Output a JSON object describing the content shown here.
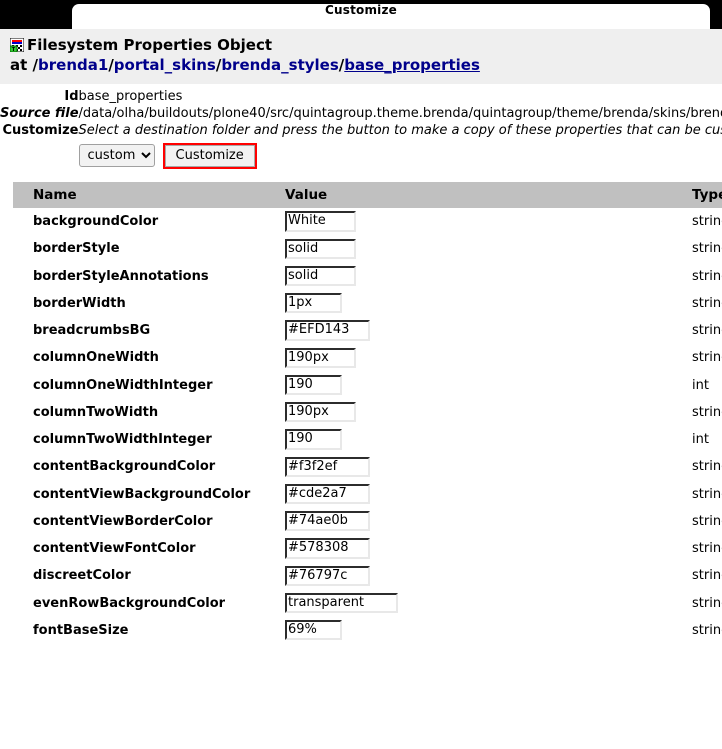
{
  "tabbar": {
    "active_tab": "Customize"
  },
  "title": {
    "icon": "properties-object-icon",
    "prefix": "Filesystem Properties Object at",
    "path_segments": [
      {
        "sep": "/",
        "text": "brenda1",
        "underline": false
      },
      {
        "sep": "/",
        "text": "portal_skins",
        "underline": false
      },
      {
        "sep": "/",
        "text": "brenda_styles",
        "underline": false
      },
      {
        "sep": "/",
        "text": "base_properties",
        "underline": true
      }
    ]
  },
  "info": {
    "rows": [
      {
        "label": "Id",
        "label_italic": false,
        "value": "base_properties",
        "value_italic": false
      },
      {
        "label": "Source file",
        "label_italic": true,
        "value": "/data/olha/buildouts/plone40/src/quintagroup.theme.brenda/quintagroup/theme/brenda/skins/brenda_styles/base_properties.props",
        "value_italic": false
      },
      {
        "label": "Customize",
        "label_italic": false,
        "value": "Select a destination folder and press the button to make a copy of these properties that can be customized.",
        "value_italic": true
      }
    ]
  },
  "form": {
    "destination_select": {
      "name": "destination-folder-select",
      "selected": "custom",
      "options": [
        "custom"
      ]
    },
    "customize_button": "Customize",
    "highlight_color": "#ff0000"
  },
  "props_table": {
    "columns": [
      "Name",
      "Value",
      "Type"
    ],
    "header_bg": "#c0c0c0",
    "rows": [
      {
        "name": "backgroundColor",
        "value": "White",
        "type": "string",
        "size": 5
      },
      {
        "name": "borderStyle",
        "value": "solid",
        "type": "string",
        "size": 5
      },
      {
        "name": "borderStyleAnnotations",
        "value": "solid",
        "type": "string",
        "size": 5
      },
      {
        "name": "borderWidth",
        "value": "1px",
        "type": "string",
        "size": 3
      },
      {
        "name": "breadcrumbsBG",
        "value": "#EFD143",
        "type": "string",
        "size": 7
      },
      {
        "name": "columnOneWidth",
        "value": "190px",
        "type": "string",
        "size": 5
      },
      {
        "name": "columnOneWidthInteger",
        "value": "190",
        "type": "int",
        "size": 3
      },
      {
        "name": "columnTwoWidth",
        "value": "190px",
        "type": "string",
        "size": 5
      },
      {
        "name": "columnTwoWidthInteger",
        "value": "190",
        "type": "int",
        "size": 3
      },
      {
        "name": "contentBackgroundColor",
        "value": "#f3f2ef",
        "type": "string",
        "size": 7
      },
      {
        "name": "contentViewBackgroundColor",
        "value": "#cde2a7",
        "type": "string",
        "size": 7
      },
      {
        "name": "contentViewBorderColor",
        "value": "#74ae0b",
        "type": "string",
        "size": 7
      },
      {
        "name": "contentViewFontColor",
        "value": "#578308",
        "type": "string",
        "size": 7
      },
      {
        "name": "discreetColor",
        "value": "#76797c",
        "type": "string",
        "size": 7
      },
      {
        "name": "evenRowBackgroundColor",
        "value": "transparent",
        "type": "string",
        "size": 11
      },
      {
        "name": "fontBaseSize",
        "value": "69%",
        "type": "string",
        "size": 3
      }
    ]
  }
}
